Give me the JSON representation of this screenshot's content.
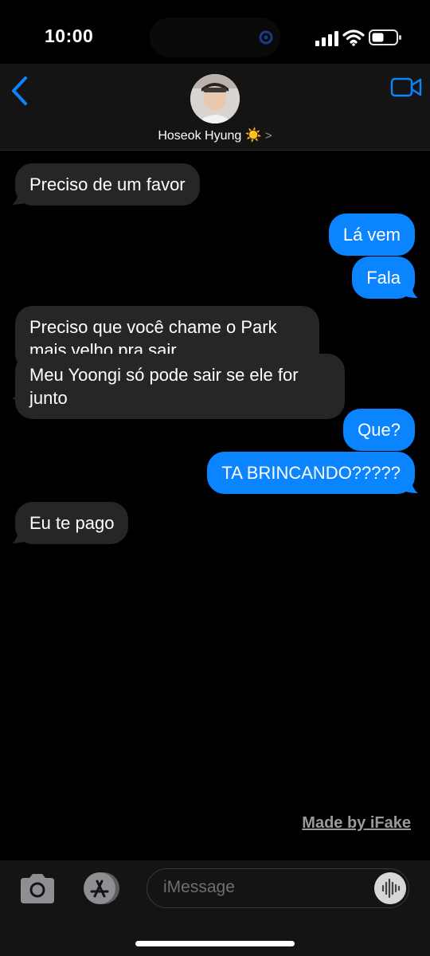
{
  "status": {
    "time": "10:00"
  },
  "header": {
    "contact_name": "Hoseok Hyung",
    "contact_emoji": "☀️",
    "chevron": ">"
  },
  "messages": [
    {
      "from": "them",
      "text": "Preciso de um favor"
    },
    {
      "from": "me",
      "text": "Lá vem"
    },
    {
      "from": "me",
      "text": "Fala"
    },
    {
      "from": "them",
      "text": "Preciso que você chame o Park\nmais velho pra sair"
    },
    {
      "from": "them",
      "text": "Meu Yoongi só pode sair se ele for\njunto"
    },
    {
      "from": "me",
      "text": "Que?"
    },
    {
      "from": "me",
      "text": "TA BRINCANDO?????"
    },
    {
      "from": "them",
      "text": "Eu te pago"
    }
  ],
  "watermark": "Made by iFake",
  "composer": {
    "placeholder": "iMessage"
  },
  "colors": {
    "accent": "#0a84ff",
    "incoming": "#262628",
    "background": "#000000"
  },
  "icons": [
    "back-chevron-icon",
    "facetime-video-icon",
    "camera-icon",
    "app-store-icon",
    "audio-waveform-icon",
    "signal-icon",
    "wifi-icon",
    "battery-icon"
  ]
}
